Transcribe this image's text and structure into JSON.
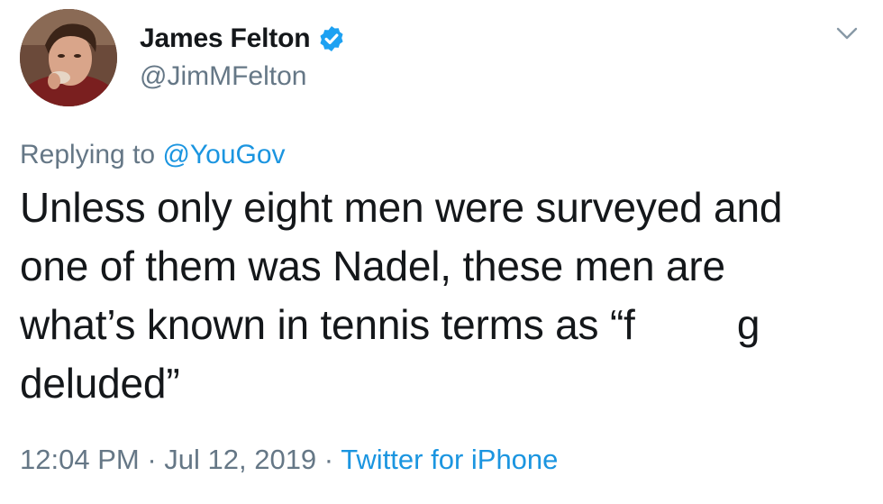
{
  "user": {
    "display_name": "James Felton",
    "handle": "@JimMFelton",
    "verified": true
  },
  "reply": {
    "prefix": "Replying to ",
    "mention": "@YouGov"
  },
  "tweet": {
    "lines": [
      "Unless only eight men were surveyed and",
      "one of them was Nadel, these men are",
      "what’s known in tennis terms as “f         g",
      "deluded”"
    ]
  },
  "meta": {
    "time": "12:04 PM",
    "separator": " · ",
    "date": "Jul 12, 2019",
    "separator2": " · ",
    "source": "Twitter for iPhone"
  },
  "icons": {
    "verified": "verified-badge-icon",
    "menu": "chevron-down-icon"
  },
  "colors": {
    "link": "#1b95e0",
    "muted": "#657786",
    "text": "#14171a",
    "verified": "#1da1f2"
  }
}
